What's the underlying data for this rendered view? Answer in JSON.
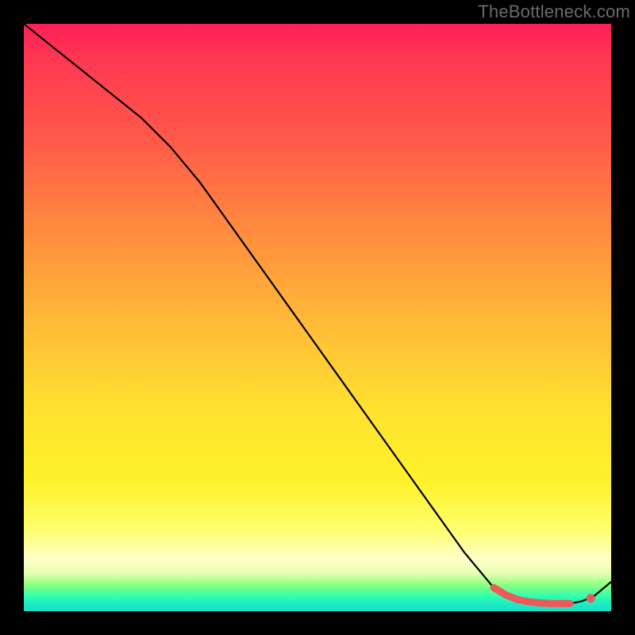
{
  "watermark": "TheBottleneck.com",
  "colors": {
    "curve": "#000000",
    "marker": "#ee5a5a",
    "background_frame": "#000000"
  },
  "chart_data": {
    "type": "line",
    "title": "",
    "xlabel": "",
    "ylabel": "",
    "xlim": [
      0,
      100
    ],
    "ylim": [
      0,
      100
    ],
    "series": [
      {
        "name": "bottleneck-curve",
        "x": [
          0,
          5,
          10,
          15,
          20,
          25,
          30,
          35,
          40,
          45,
          50,
          55,
          60,
          65,
          70,
          75,
          80,
          83,
          85,
          87,
          89,
          91,
          93,
          95,
          97,
          100
        ],
        "y": [
          100,
          96,
          92,
          88,
          84,
          79,
          73,
          66,
          59,
          52,
          45,
          38,
          31,
          24,
          17,
          10,
          4,
          2,
          1.5,
          1.3,
          1.2,
          1.2,
          1.3,
          1.7,
          2.5,
          5
        ]
      }
    ],
    "highlight": {
      "name": "optimal-range",
      "x": [
        80,
        82,
        84,
        86,
        88,
        90,
        92,
        93
      ],
      "y": [
        4.0,
        2.8,
        2.0,
        1.6,
        1.4,
        1.3,
        1.3,
        1.3
      ],
      "end_dot": {
        "x": 96.5,
        "y": 2.2
      }
    }
  }
}
